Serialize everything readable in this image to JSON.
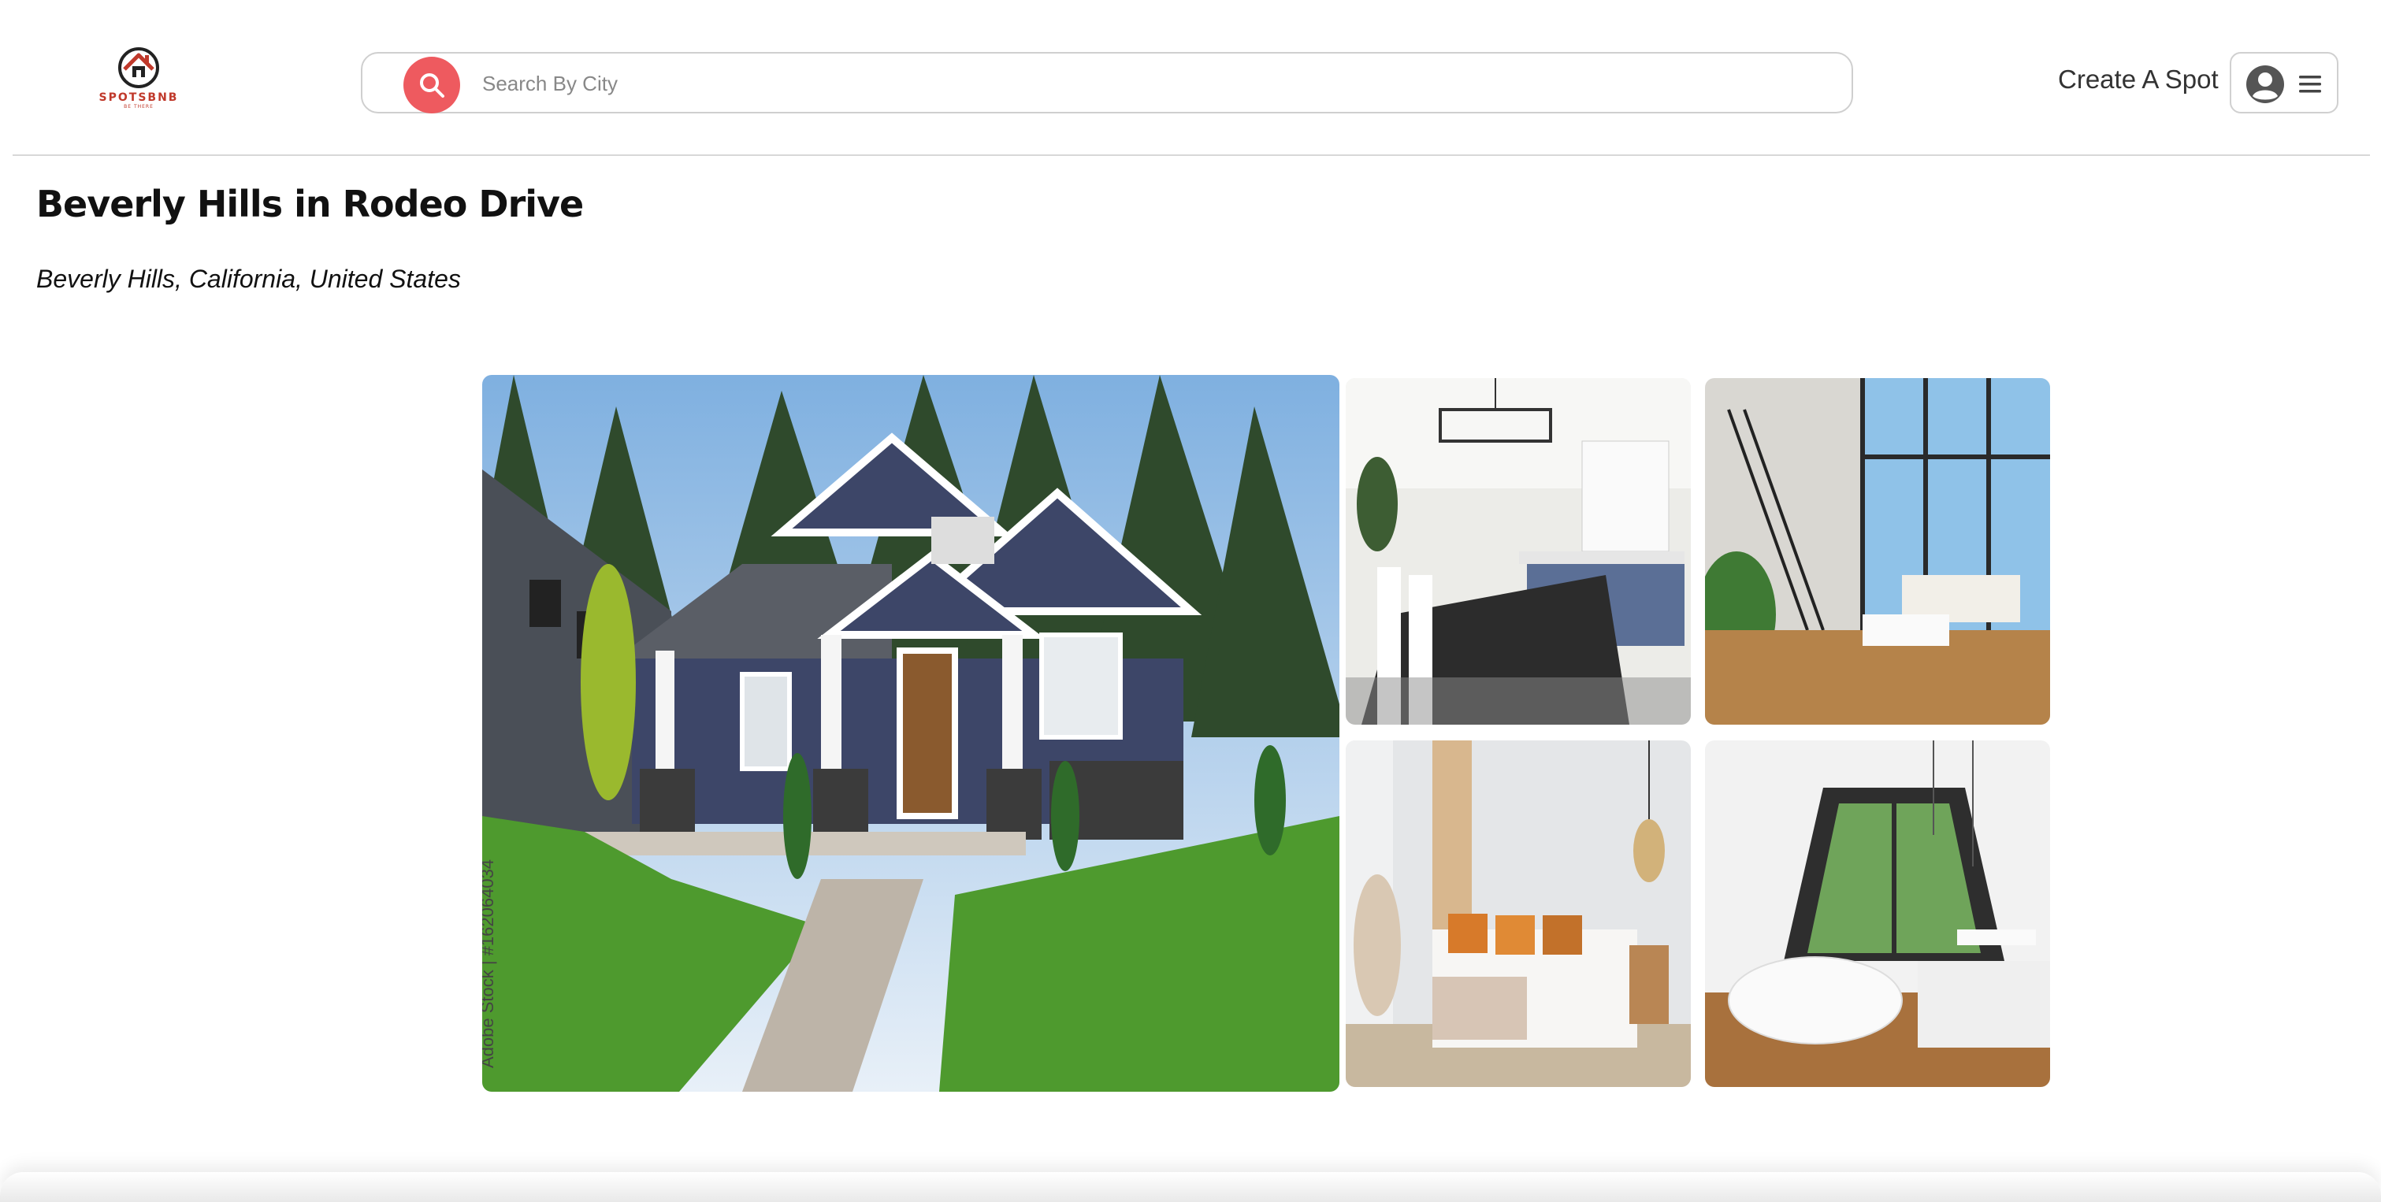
{
  "header": {
    "logo": {
      "brand": "SPOTSBNB",
      "tagline": "BE THERE"
    },
    "search": {
      "placeholder": "Search By City",
      "value": ""
    },
    "create_spot_label": "Create A Spot",
    "icons": {
      "search": "search-icon",
      "avatar": "user-circle-icon",
      "menu": "hamburger-menu-icon"
    }
  },
  "spot": {
    "title": "Beverly Hills in Rodeo Drive",
    "location": "Beverly Hills, California, United States",
    "main_image_watermark": "Adobe Stock | #162064034"
  },
  "colors": {
    "accent": "#ee5a5f",
    "brand": "#c0392b",
    "text": "#111111"
  }
}
